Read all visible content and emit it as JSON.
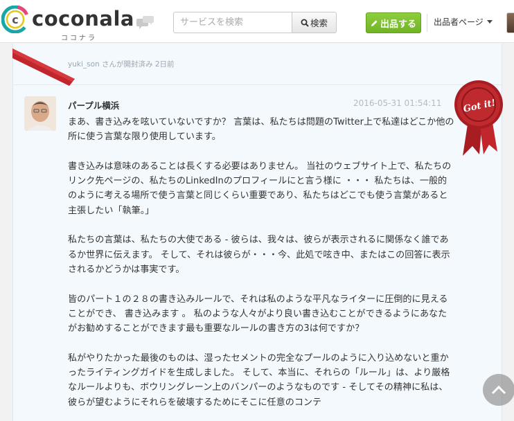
{
  "header": {
    "logo_text": "coconala",
    "logo_kana": "ココナラ",
    "search_placeholder": "サービスを検索",
    "search_button": "検索",
    "sell_button": "出品する",
    "seller_menu": "出品者ページ"
  },
  "message": {
    "opened_notice": "yuki_son さんが開封済み 2日前",
    "author": "パープル横浜",
    "timestamp": "2016-05-31 01:54:11",
    "badge_text": "Got it!",
    "paragraphs": [
      "まあ、書き込みを呟いていないですか？ 言葉は、私たちは問題のTwitter上で私達はどこか他の所に使う言葉な限り使用しています。",
      "書き込みは意味のあることは長くする必要はありません。 当社のウェブサイト上で、私たちのリンク先ページの、私たちのLinkedInのプロフィールにと言う様に ・・・ 私たちは、一般的のように考える場所で使う言葉と同じくらい重要であり、私たちはどこでも使う言葉があると主張したい「執筆。」",
      "私たちの言葉は、私たちの大使である - 彼らは、我々は、彼らが表示されるに関係なく誰であるか世界に伝えます。 そして、それは彼らが・・・今、此処で呟き中、またはこの回答に表示されるかどうかは事実です。",
      "皆のパート１の２８の書き込みルールで、それは私のような平凡なライターに圧倒的に見えることができ、 書き込みます 。 私のような人々がより良い書き込むことができるようにあなたがお勧めすることができます最も重要なルールの書き方の3は何ですか？",
      "私がやりたかった最後のものは、湿ったセメントの完全なプールのように入り込めないと重かったライティングガイドを生成しました。 そして、本当に、それらの「ルール」は、より厳格なルールよりも、ボウリングレーン上のバンパーのようなものです - そしてその精神に私は、彼らが望むようにそれらを破壊するためにそこに任意のコンテ"
    ]
  },
  "colors": {
    "accent_green": "#7cc12f",
    "logo_teal": "#1aa6a6",
    "ribbon_red": "#c0262b",
    "panel_bg": "#f4f9fd"
  },
  "icons": [
    "chat-bubble-icon",
    "magnifier-icon",
    "pencil-icon",
    "chevron-down-icon",
    "chevron-up-icon"
  ]
}
